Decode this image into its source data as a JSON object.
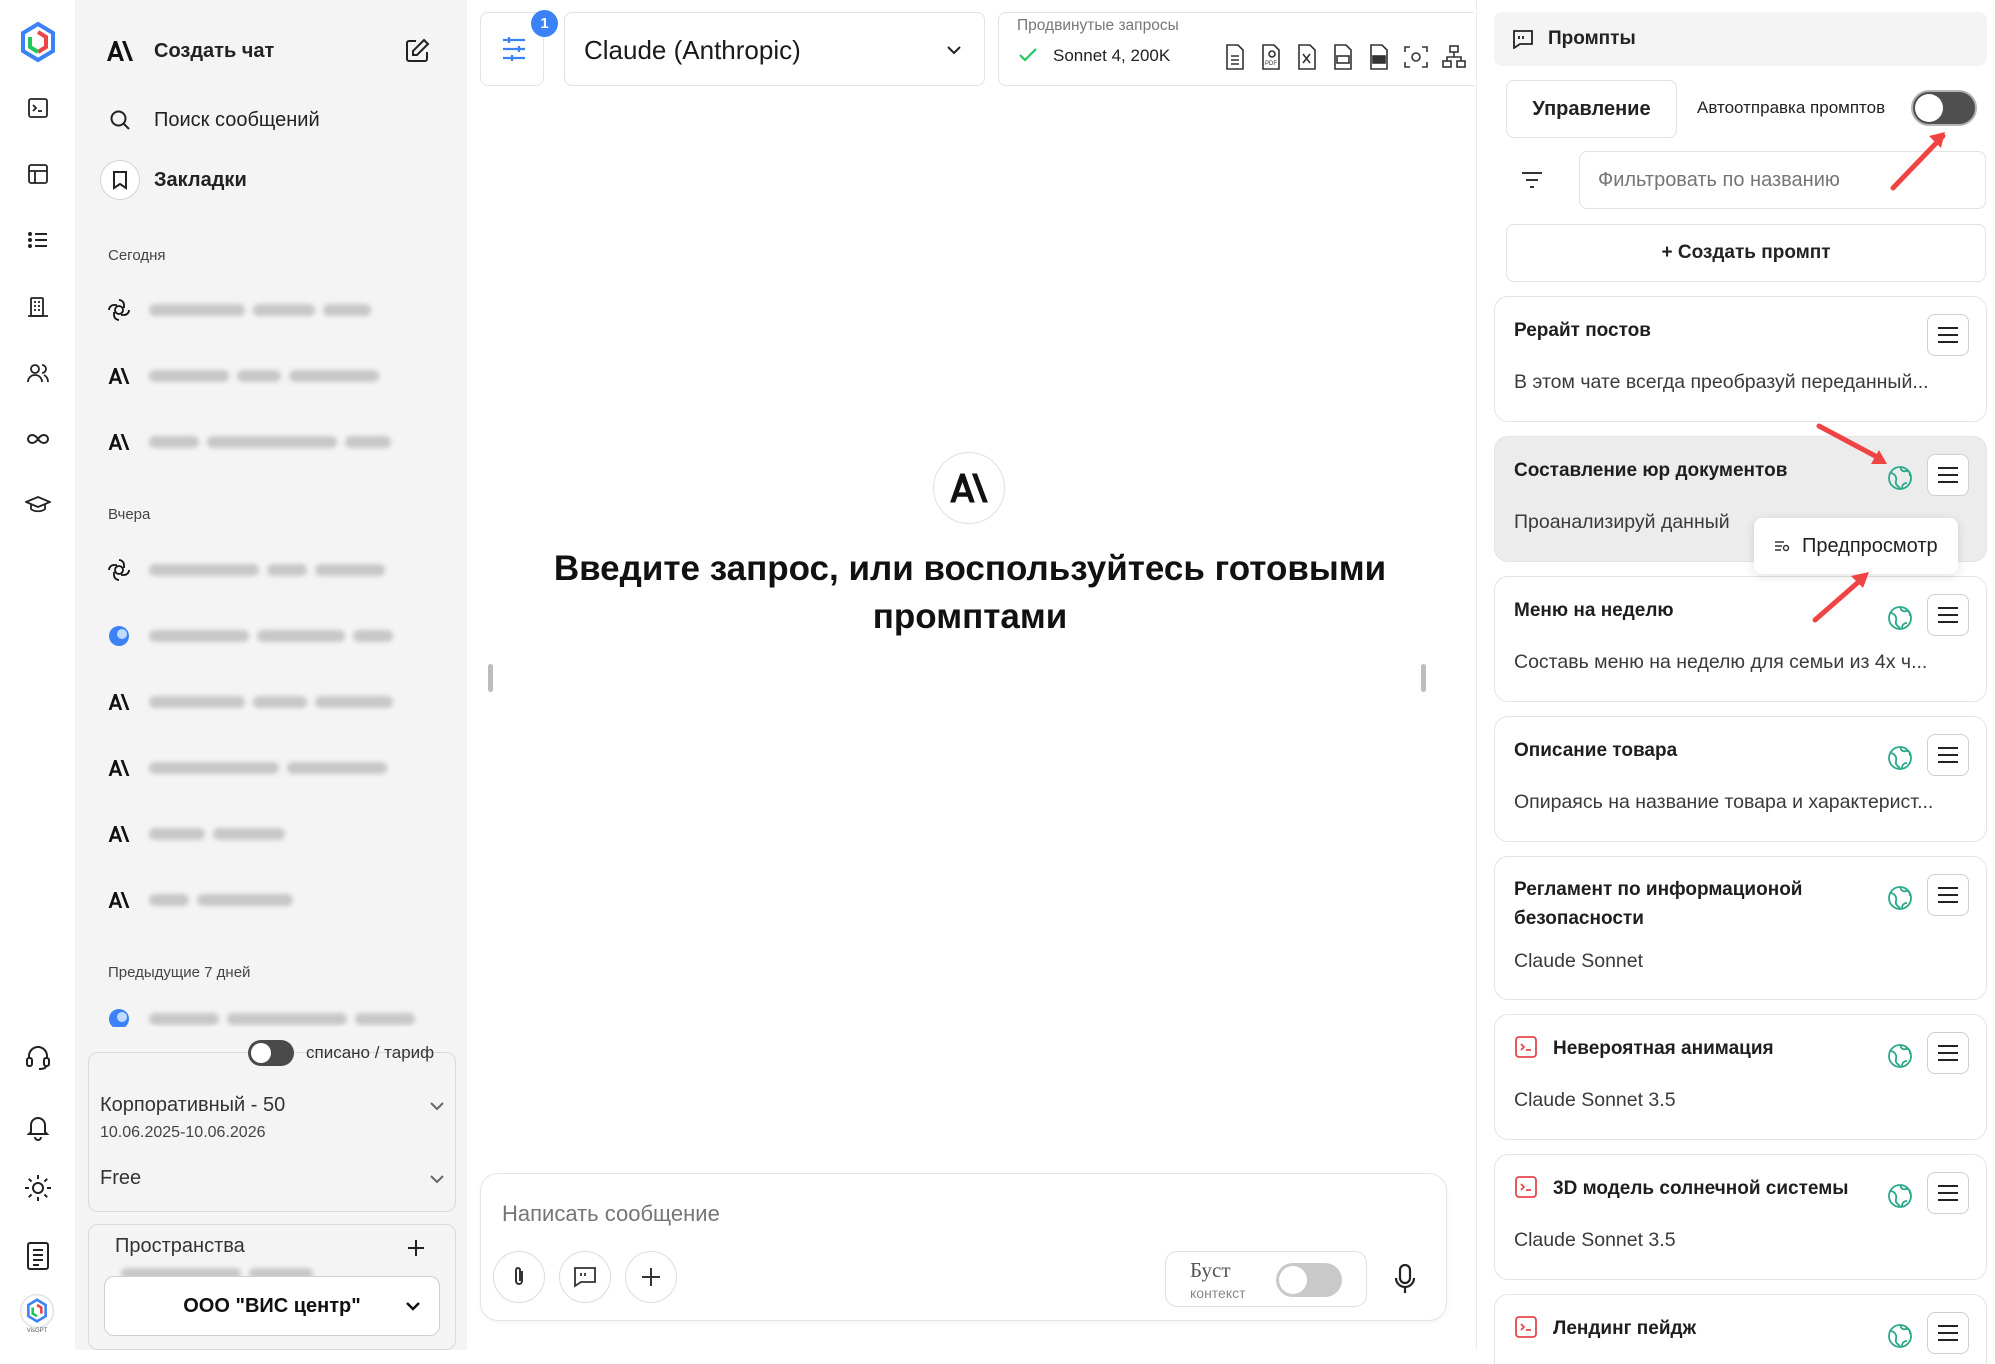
{
  "sidebar": {
    "new_chat_label": "Создать чат",
    "search_label": "Поиск сообщений",
    "bookmarks_label": "Закладки",
    "sections": {
      "today": "Сегодня",
      "yesterday": "Вчера",
      "prev7": "Предыдущие 7 дней"
    },
    "billing_toggle_label": "списано / тариф",
    "plan_name": "Корпоративный - 50",
    "plan_dates": "10.06.2025-10.06.2026",
    "plan_tier": "Free",
    "spaces_label": "Пространства",
    "org_name": "ООО \"ВИС центр\""
  },
  "rail": {
    "logo_caption": "VisGPT"
  },
  "header": {
    "settings_badge": "1",
    "model_name": "Claude (Anthropic)",
    "advanced_label": "Продвинутые запросы",
    "model_variant": "Sonnet 4, 200K"
  },
  "main": {
    "prompt_line1": "Введите запрос, или воспользуйтесь готовыми",
    "prompt_line2": "промптами"
  },
  "composer": {
    "placeholder": "Написать сообщение",
    "boost_label": "Буст",
    "boost_sub": "контекст"
  },
  "panel": {
    "title": "Промпты",
    "manage_tab": "Управление",
    "autosend_label": "Автоотправка промптов",
    "filter_placeholder": "Фильтровать по названию",
    "create_button": "+ Создать промпт",
    "preview_tooltip": "Предпросмотр",
    "prompts": [
      {
        "title": "Рерайт постов",
        "desc": "В этом чате всегда преобразуй переданный..."
      },
      {
        "title": "Составление юр документов",
        "desc": "Проанализируй данный"
      },
      {
        "title": "Меню на неделю",
        "desc": "Составь меню на неделю для семьи из 4х ч..."
      },
      {
        "title": "Описание товара",
        "desc": "Опираясь на название товара и характерист..."
      },
      {
        "title": "Регламент по информационой безопасности",
        "desc": "Claude Sonnet"
      },
      {
        "title": "Невероятная анимация",
        "desc": "Claude Sonnet 3.5"
      },
      {
        "title": "3D модель солнечной системы",
        "desc": "Claude Sonnet 3.5"
      },
      {
        "title": "Лендинг пейдж",
        "desc": ""
      }
    ]
  },
  "colors": {
    "accent": "#3b82f6",
    "toggle_off": "#c9c9c9",
    "annotation_arrow": "#ef4444",
    "globe": "#2aa88a",
    "slash_icon": "#e5484d"
  }
}
